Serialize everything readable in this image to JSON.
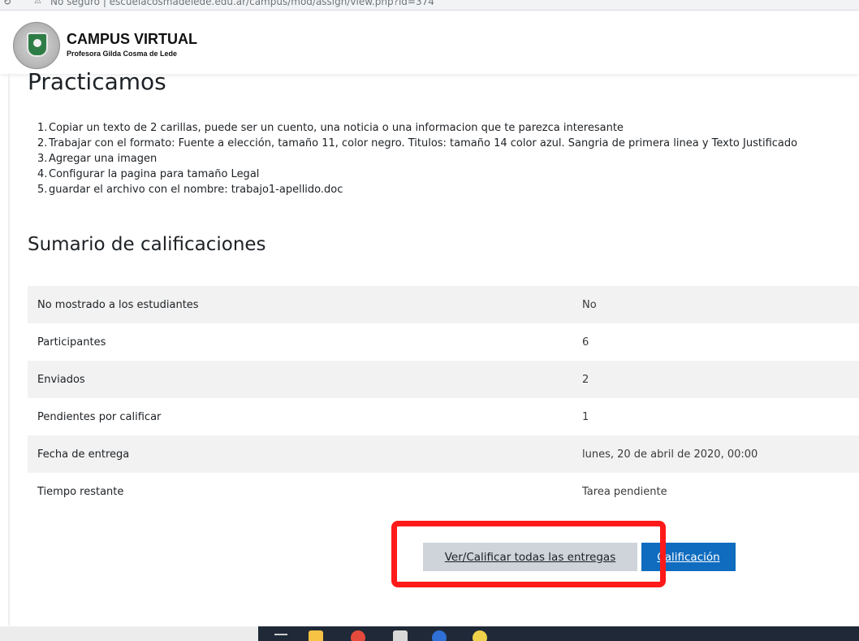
{
  "browser": {
    "url_text": "No seguro | escuelacosmadelede.edu.ar/campus/mod/assign/view.php?id=374",
    "reload_icon": "reload-icon",
    "lock_icon": "warning-lock-icon"
  },
  "header": {
    "logo_icon": "school-crest-icon",
    "title": "CAMPUS VIRTUAL",
    "subtitle": "Profesora Gilda Cosma de Lede"
  },
  "main": {
    "title": "Practicamos",
    "tasks": [
      {
        "num": "1.",
        "text": "Copiar un texto de 2 carillas, puede ser un cuento, una noticia o una informacion que te parezca interesante"
      },
      {
        "num": "2.",
        "text": "Trabajar con el formato: Fuente a elección, tamaño 11, color negro. Titulos: tamaño 14 color azul. Sangria de primera linea y Texto Justificado"
      },
      {
        "num": "3.",
        "text": "Agregar una imagen"
      },
      {
        "num": "4.",
        "text": "Configurar la pagina para tamaño Legal"
      },
      {
        "num": "5.",
        "text": "guardar el archivo con el nombre: trabajo1-apellido.doc"
      }
    ]
  },
  "summary": {
    "title": "Sumario de calificaciones",
    "rows": [
      {
        "label": "No mostrado a los estudiantes",
        "value": "No"
      },
      {
        "label": "Participantes",
        "value": "6"
      },
      {
        "label": "Enviados",
        "value": "2"
      },
      {
        "label": "Pendientes por calificar",
        "value": "1"
      },
      {
        "label": "Fecha de entrega",
        "value": "lunes, 20 de abril de 2020, 00:00"
      },
      {
        "label": "Tiempo restante",
        "value": "Tarea pendiente"
      }
    ]
  },
  "actions": {
    "view_all_label": "Ver/Calificar todas las entregas",
    "grade_label": "Calificación"
  },
  "colors": {
    "primary": "#0f6cbf",
    "secondary": "#ced4da",
    "highlight": "#ff1a1a",
    "stripe": "#f2f2f2"
  }
}
